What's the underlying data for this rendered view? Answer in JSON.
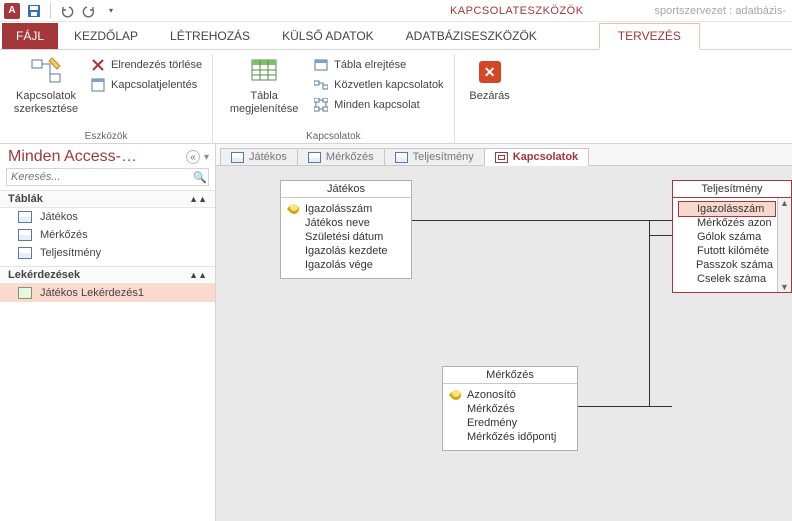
{
  "titlebar": {
    "context_tool": "KAPCSOLATESZKÖZÖK",
    "file_title": "sportszervezet : adatbázis-"
  },
  "maintabs": {
    "file": "FÁJL",
    "home": "KEZDŐLAP",
    "create": "LÉTREHOZÁS",
    "external": "KÜLSŐ ADATOK",
    "dbtools": "ADATBÁZISESZKÖZÖK",
    "design": "TERVEZÉS"
  },
  "ribbon": {
    "edit_relationships": "Kapcsolatok szerkesztése",
    "clear_layout": "Elrendezés törlése",
    "rel_report": "Kapcsolatjelentés",
    "group_tools": "Eszközök",
    "show_table": "Tábla megjelenítése",
    "hide_table": "Tábla elrejtése",
    "direct_rel": "Közvetlen kapcsolatok",
    "all_rel": "Minden kapcsolat",
    "group_relationships": "Kapcsolatok",
    "close": "Bezárás"
  },
  "navpane": {
    "title": "Minden Access-…",
    "search_placeholder": "Keresés...",
    "section_tables": "Táblák",
    "section_queries": "Lekérdezések",
    "tables": [
      "Játékos",
      "Mérkőzés",
      "Teljesítmény"
    ],
    "queries": [
      "Játékos Lekérdezés1"
    ]
  },
  "doctabs": {
    "t1": "Játékos",
    "t2": "Mérkőzés",
    "t3": "Teljesítmény",
    "t4": "Kapcsolatok"
  },
  "diagram": {
    "jatekos": {
      "title": "Játékos",
      "f0": "Igazolásszám",
      "f1": "Játékos neve",
      "f2": "Születési dátum",
      "f3": "Igazolás kezdete",
      "f4": "Igazolás vége"
    },
    "merkozes": {
      "title": "Mérkőzés",
      "f0": "Azonosító",
      "f1": "Mérkőzés",
      "f2": "Eredmény",
      "f3": "Mérkőzés időpontj"
    },
    "teljesitmeny": {
      "title": "Teljesítmény",
      "f0": "Igazolásszám",
      "f1": "Mérkőzés azon",
      "f2": "Gólok száma",
      "f3": "Futott kilóméte",
      "f4": "Passzok száma",
      "f5": "Cselek száma"
    }
  }
}
